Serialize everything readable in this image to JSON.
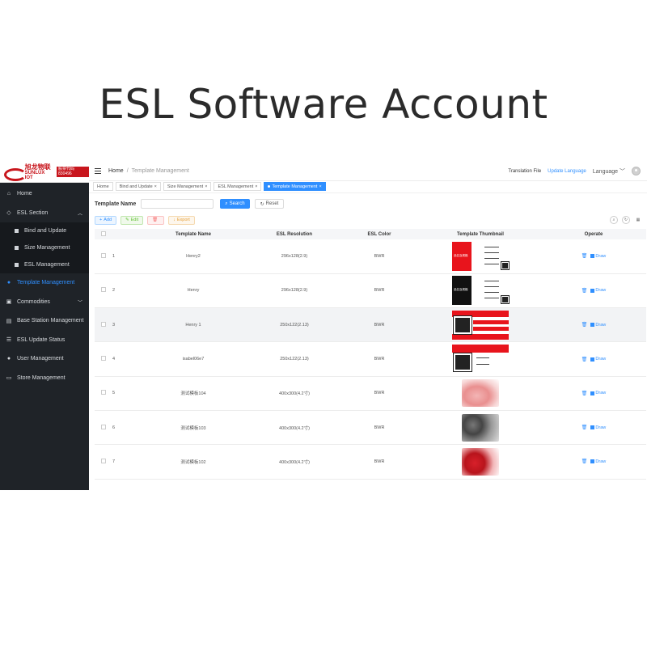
{
  "hero_title": "ESL Software Account",
  "logo": {
    "cn": "旭龙物联",
    "en": "SUNLUX IOT",
    "badge": "股票代码 830496"
  },
  "sidebar": {
    "items": [
      {
        "label": "Home",
        "icon": "home-icon"
      },
      {
        "label": "ESL Section",
        "icon": "tag-icon"
      },
      {
        "label": "Bind and Update",
        "icon": "square-icon"
      },
      {
        "label": "Size Management",
        "icon": "square-icon"
      },
      {
        "label": "ESL Management",
        "icon": "square-icon"
      },
      {
        "label": "Template Management",
        "icon": "globe-icon"
      },
      {
        "label": "Commodities",
        "icon": "box-icon"
      },
      {
        "label": "Base Station Management",
        "icon": "station-icon"
      },
      {
        "label": "ESL Update Status",
        "icon": "list-icon"
      },
      {
        "label": "User Management",
        "icon": "user-icon"
      },
      {
        "label": "Store Management",
        "icon": "store-icon"
      }
    ]
  },
  "topbar": {
    "breadcrumb_home": "Home",
    "breadcrumb_sep": "/",
    "breadcrumb_current": "Template Management",
    "translation_file": "Translation File",
    "update_language": "Update Language",
    "language": "Language"
  },
  "tabs": [
    {
      "label": "Home"
    },
    {
      "label": "Bind and Update"
    },
    {
      "label": "Size Management"
    },
    {
      "label": "ESL Management"
    },
    {
      "label": "Template Management"
    }
  ],
  "search": {
    "label": "Template Name",
    "placeholder": "",
    "search_label": "Search",
    "reset_label": "Reset"
  },
  "actions": {
    "add": "Add",
    "edit": "Edit",
    "delete": "",
    "export": "Export"
  },
  "table": {
    "headers": [
      "Template Name",
      "ESL Resolution",
      "ESL Color",
      "Template Thumbnail",
      "Operate"
    ],
    "draw_label": "Draw",
    "rows": [
      {
        "idx": "1",
        "name": "Henry2",
        "resolution": "296x128(2.9)",
        "color": "BWR",
        "thumb": "red-tag"
      },
      {
        "idx": "2",
        "name": "Henry",
        "resolution": "296x128(2.9)",
        "color": "BWR",
        "thumb": "black-tag"
      },
      {
        "idx": "3",
        "name": "Henry 1",
        "resolution": "250x122(2.13)",
        "color": "BWR",
        "thumb": "red-qr-tag"
      },
      {
        "idx": "4",
        "name": "isabel06e7",
        "resolution": "250x122(2.13)",
        "color": "BWR",
        "thumb": "red-header-tag"
      },
      {
        "idx": "5",
        "name": "测试模板104",
        "resolution": "400x300(4.2寸)",
        "color": "BWR",
        "thumb": "photo-pink"
      },
      {
        "idx": "6",
        "name": "测试模板103",
        "resolution": "400x300(4.2寸)",
        "color": "BWR",
        "thumb": "photo-grey"
      },
      {
        "idx": "7",
        "name": "测试模板102",
        "resolution": "400x300(4.2寸)",
        "color": "BWR",
        "thumb": "photo-red"
      }
    ]
  },
  "colors": {
    "sidebar_bg": "#1f2328",
    "accent": "#2f8fff",
    "tag_red": "#e8141c"
  }
}
